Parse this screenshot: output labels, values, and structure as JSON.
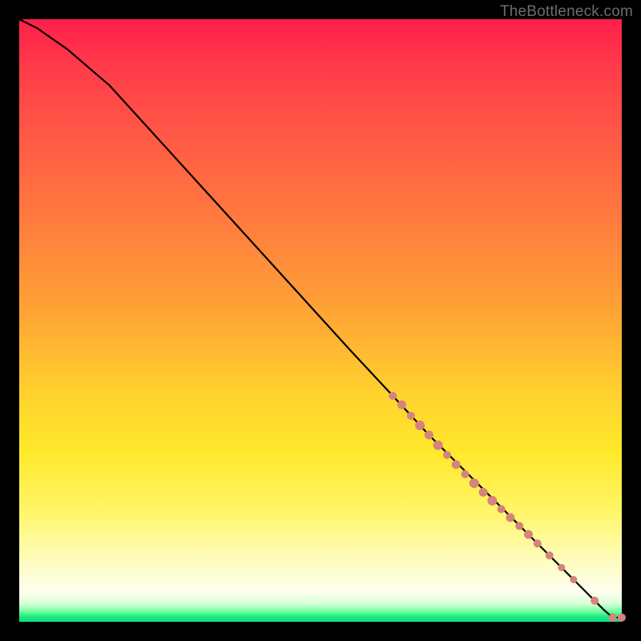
{
  "watermark": "TheBottleneck.com",
  "colors": {
    "curve": "#000000",
    "point": "#d5837c",
    "background": "#000000"
  },
  "chart_data": {
    "type": "line",
    "title": "",
    "xlabel": "",
    "ylabel": "",
    "xlim": [
      0,
      100
    ],
    "ylim": [
      0,
      100
    ],
    "grid": false,
    "legend": false,
    "series": [
      {
        "name": "bottleneck-curve",
        "x": [
          0,
          3,
          8,
          15,
          25,
          35,
          45,
          55,
          62,
          68,
          74,
          78,
          82,
          85,
          88,
          90,
          92,
          94,
          95.5,
          97,
          98.5,
          100
        ],
        "y": [
          100,
          98.5,
          95,
          89,
          78,
          67,
          56,
          45,
          37.5,
          31,
          25,
          21,
          17,
          14,
          11,
          9,
          7,
          5,
          3.5,
          2,
          0.7,
          0.7
        ]
      }
    ],
    "points": {
      "name": "highlighted-samples",
      "x": [
        62,
        63.5,
        65,
        66.5,
        68,
        69.5,
        71,
        72.5,
        74,
        75.5,
        77,
        78.5,
        80,
        81.5,
        83,
        84.5,
        86,
        88,
        90,
        92,
        95.5,
        98.5,
        100
      ],
      "y": [
        37.5,
        36,
        34.2,
        32.6,
        31,
        29.3,
        27.7,
        26.1,
        24.5,
        23,
        21.5,
        20.1,
        18.7,
        17.3,
        15.9,
        14.5,
        13,
        11,
        9,
        7,
        3.5,
        0.7,
        0.7
      ],
      "r": [
        5,
        5.5,
        5,
        6,
        5.5,
        6,
        5,
        5.5,
        5,
        6,
        5.5,
        6,
        5,
        5.5,
        5,
        5.5,
        5,
        5,
        4.5,
        4.5,
        5,
        5,
        5
      ]
    }
  }
}
